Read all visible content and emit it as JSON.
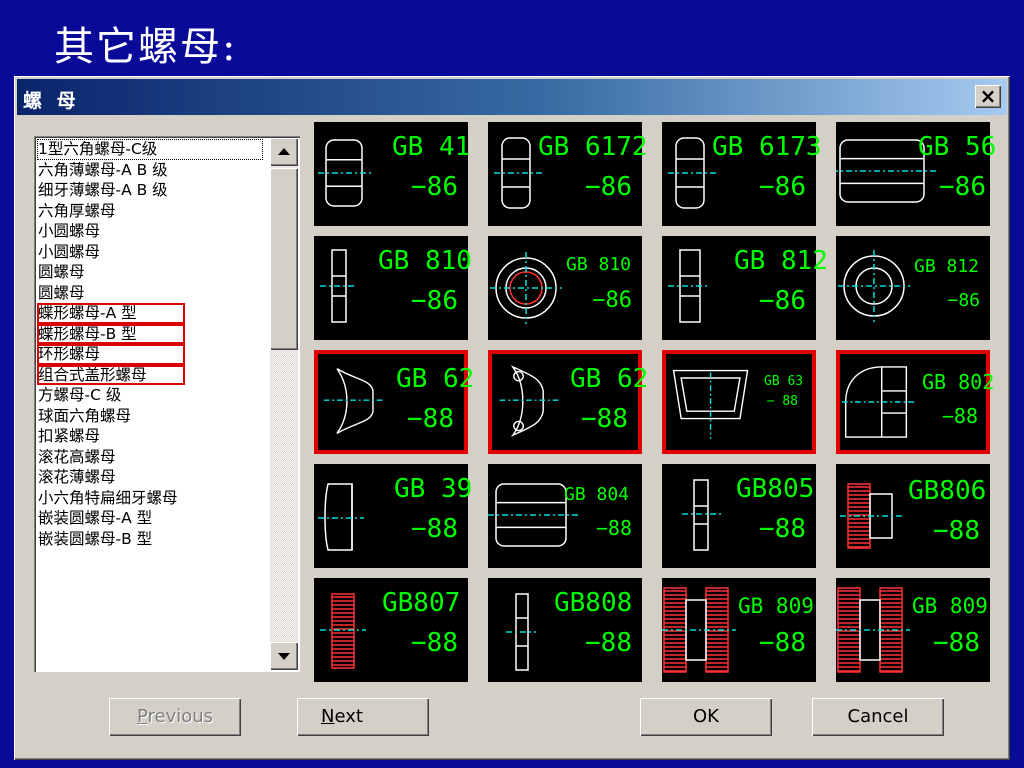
{
  "slide": {
    "title": "其它螺母:"
  },
  "dialog": {
    "title": "螺 母",
    "close_label": "×",
    "list_items": [
      "1型六角螺母-C级",
      "六角薄螺母-A B 级",
      "细牙薄螺母-A B 级",
      "六角厚螺母",
      "小圆螺母",
      "小圆螺母",
      "圆螺母",
      "圆螺母",
      "蝶形螺母-A 型",
      "蝶形螺母-B 型",
      "环形螺母",
      "组合式盖形螺母",
      "方螺母-C 级",
      "球面六角螺母",
      "扣紧螺母",
      "滚花高螺母",
      "滚花薄螺母",
      "小六角特扁细牙螺母",
      "嵌装圆螺母-A 型",
      "嵌装圆螺母-B 型"
    ],
    "tiles": [
      {
        "code": "GB 41",
        "year": "−86"
      },
      {
        "code": "GB 6172",
        "year": "−86"
      },
      {
        "code": "GB 6173",
        "year": "−86"
      },
      {
        "code": "GB 56",
        "year": "−86"
      },
      {
        "code": "GB 810",
        "year": "−86"
      },
      {
        "code": "GB 810",
        "year": "−86"
      },
      {
        "code": "GB 812",
        "year": "−86"
      },
      {
        "code": "GB 812",
        "year": "−86"
      },
      {
        "code": "GB 62",
        "year": "−88"
      },
      {
        "code": "GB 62",
        "year": "−88"
      },
      {
        "code": "GB 63",
        "year": "− 88"
      },
      {
        "code": "GB 802",
        "year": "−88"
      },
      {
        "code": "GB 39",
        "year": "−88"
      },
      {
        "code": "GB 804",
        "year": "−88"
      },
      {
        "code": "GB805",
        "year": "−88"
      },
      {
        "code": "GB806",
        "year": "−88"
      },
      {
        "code": "GB807",
        "year": "−88"
      },
      {
        "code": "GB808",
        "year": "−88"
      },
      {
        "code": "GB 809",
        "year": "−88"
      },
      {
        "code": "GB 809",
        "year": "−88"
      }
    ],
    "buttons": {
      "previous_mnemonic": "P",
      "previous_rest": "revious",
      "next_mnemonic": "N",
      "next_rest": "ext",
      "ok": "OK",
      "cancel": "Cancel"
    }
  },
  "colors": {
    "desktop": "#0a0a99",
    "label_green": "#00ff00",
    "highlight_red": "#e00000"
  }
}
